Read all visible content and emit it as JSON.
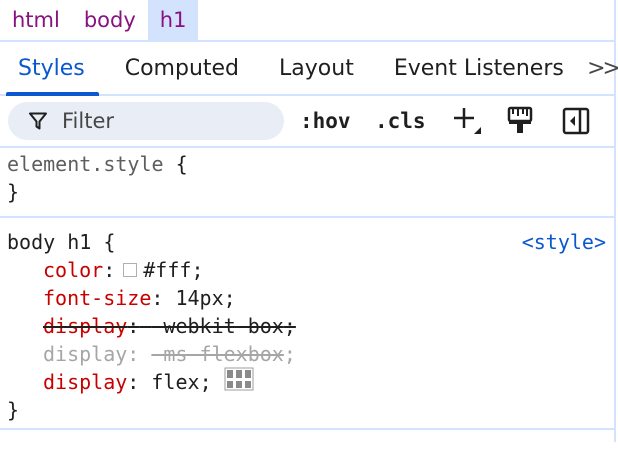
{
  "breadcrumb": {
    "items": [
      {
        "label": "html"
      },
      {
        "label": "body"
      },
      {
        "label": "h1"
      }
    ]
  },
  "tabs": {
    "items": [
      {
        "label": "Styles"
      },
      {
        "label": "Computed"
      },
      {
        "label": "Layout"
      },
      {
        "label": "Event Listeners"
      }
    ],
    "more_label": ">>"
  },
  "toolbar": {
    "filter_placeholder": "Filter",
    "hov_label": ":hov",
    "cls_label": ".cls",
    "icons": [
      "filter-icon",
      "new-style-rule-icon",
      "rendering-emulation-icon",
      "toggle-sidebar-icon"
    ]
  },
  "rules": {
    "element_style": {
      "selector": "element.style",
      "open_brace": "{",
      "close_brace": "}"
    },
    "body_h1": {
      "selector": "body h1",
      "open_brace": "{",
      "close_brace": "}",
      "source": "<style>",
      "declarations": [
        {
          "property": "color",
          "colon": ":",
          "value": "#fff",
          "semicolon": ";",
          "swatch_color": "#ffffff"
        },
        {
          "property": "font-size",
          "colon": ":",
          "value": "14px",
          "semicolon": ";"
        },
        {
          "property": "display",
          "colon": ":",
          "value": "-webkit-box",
          "semicolon": ";",
          "status": "overridden"
        },
        {
          "property": "display",
          "colon": ":",
          "value": "-ms-flexbox",
          "semicolon": ";",
          "status": "inactive"
        },
        {
          "property": "display",
          "colon": ":",
          "value": "flex",
          "semicolon": ";",
          "editor_icon": "flexbox-editor-icon"
        }
      ]
    }
  },
  "colors": {
    "accent": "#0b57d0",
    "property": "#c80000",
    "tag": "#881280",
    "divider": "#d3e3fd",
    "filter_bg": "#e9eef6"
  }
}
